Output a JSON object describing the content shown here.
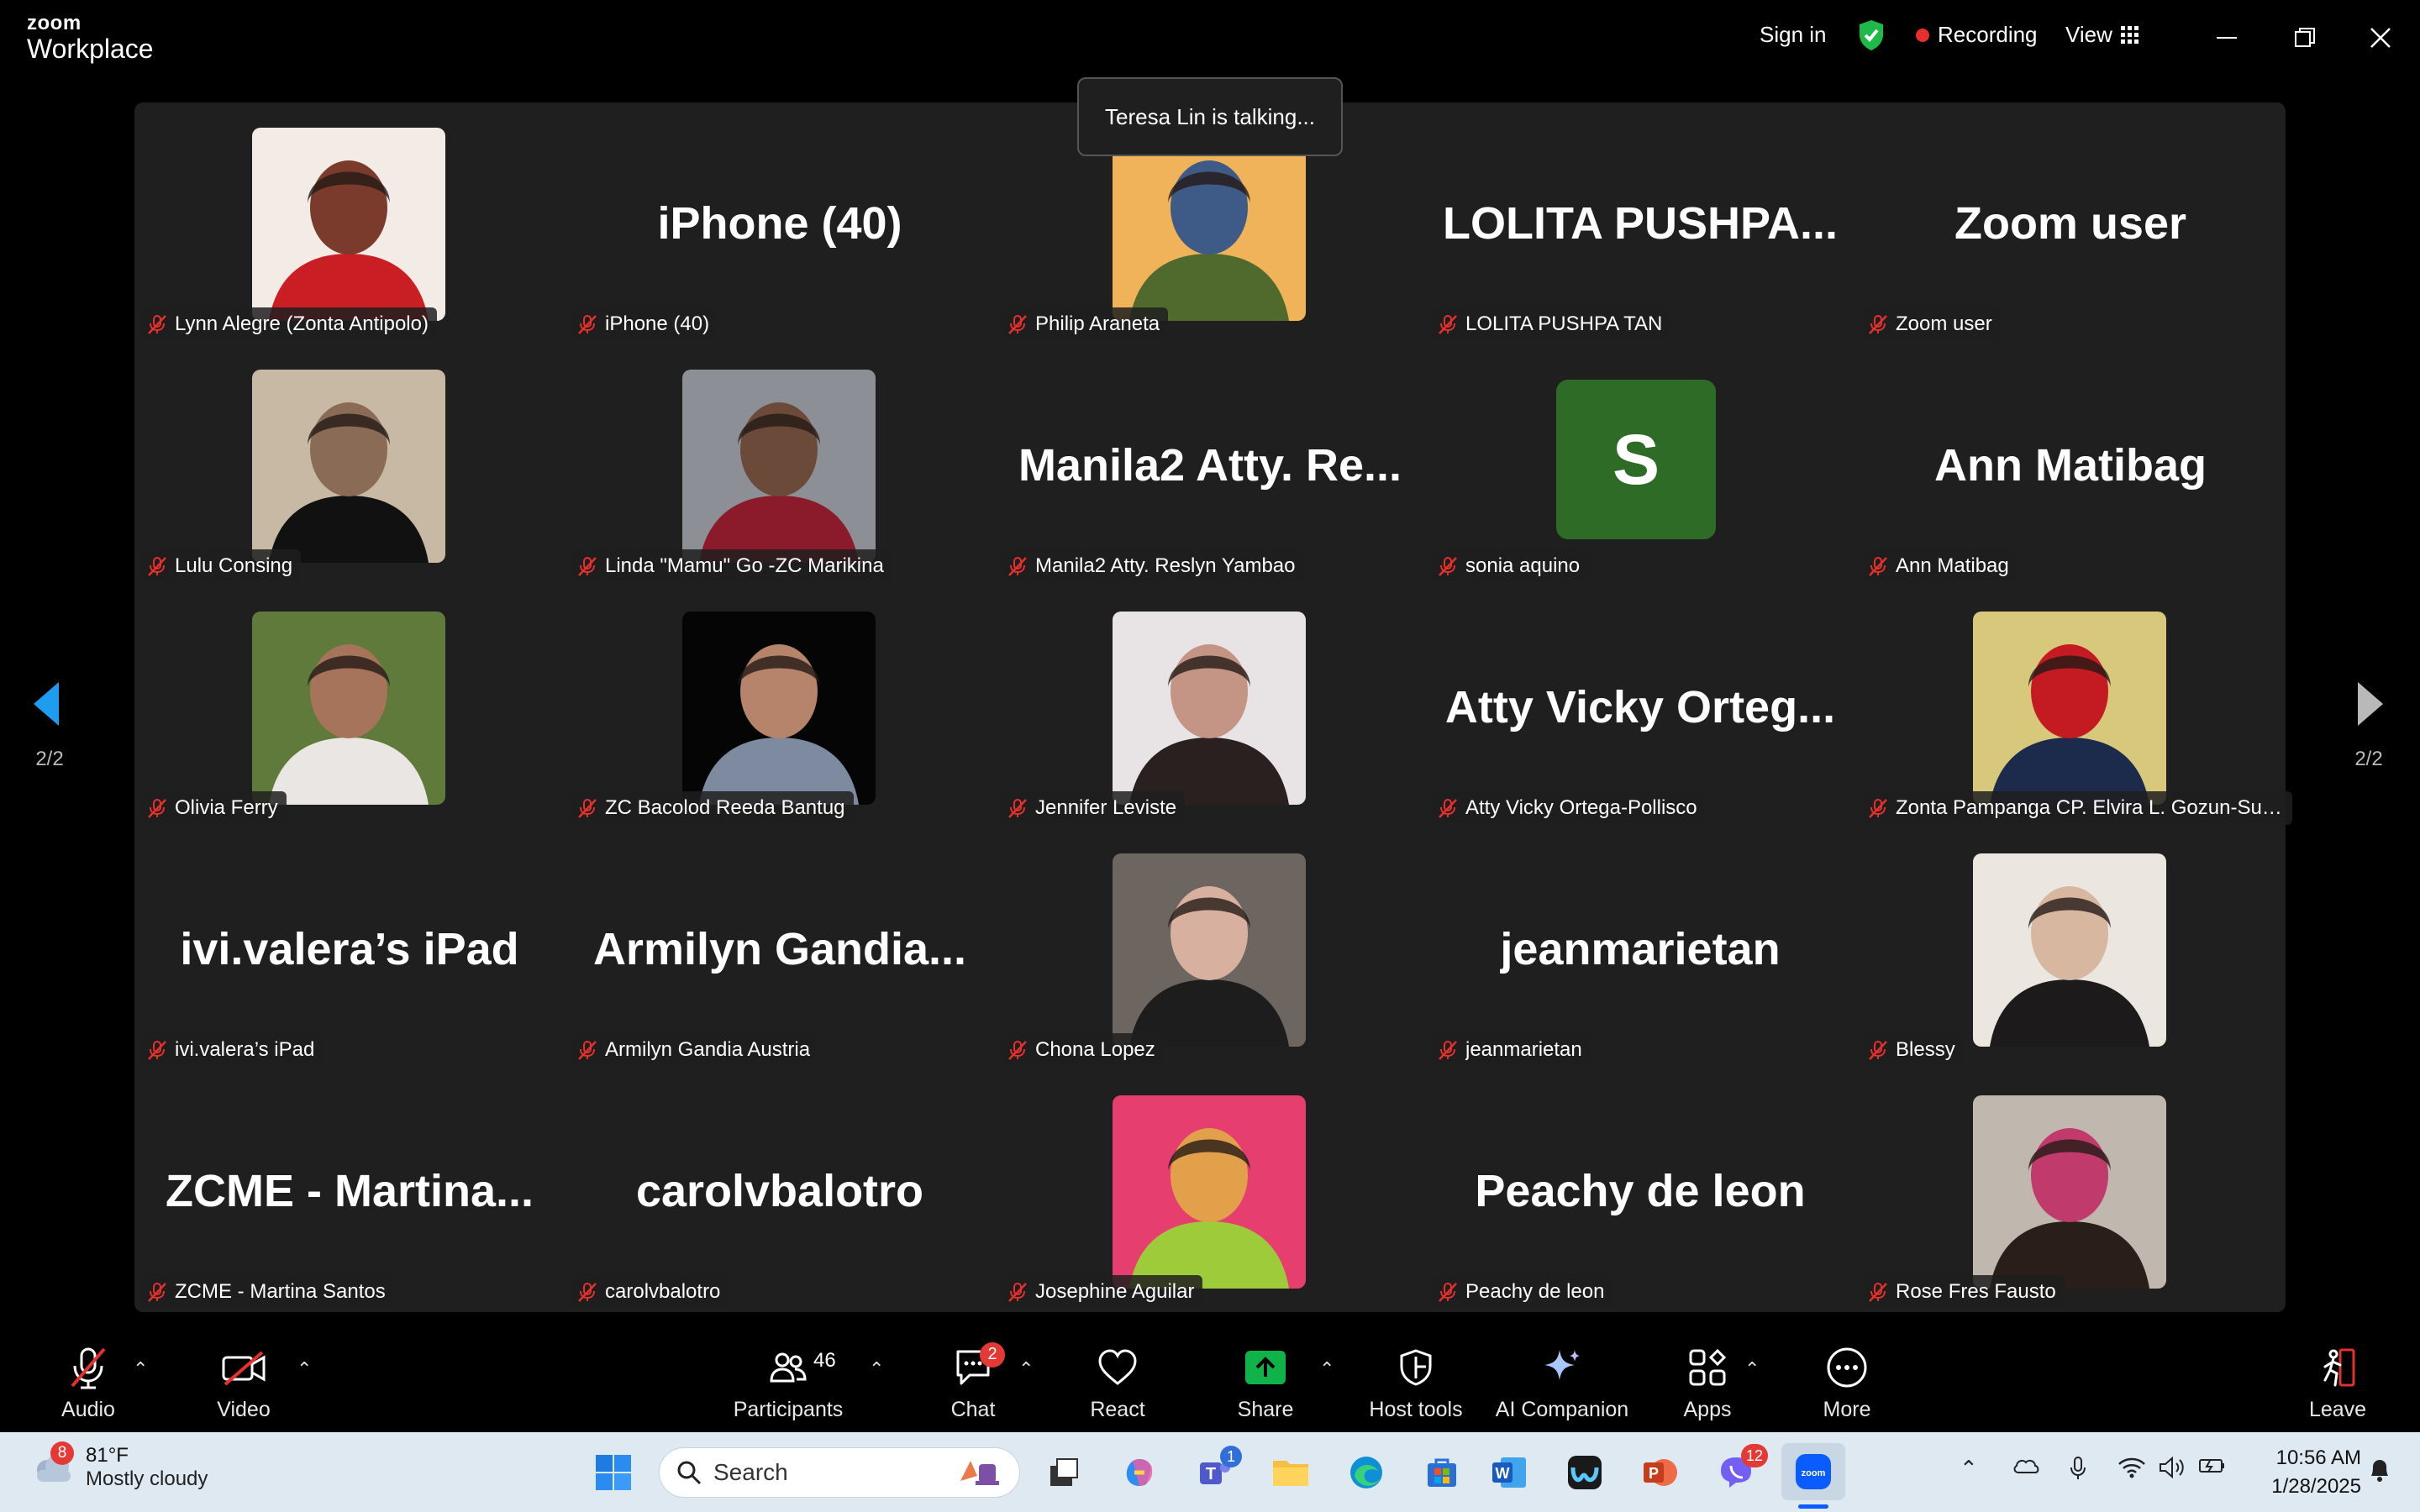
{
  "window": {
    "logo_small": "zoom",
    "logo_large": "Workplace",
    "sign_in": "Sign in",
    "recording": "Recording",
    "view": "View"
  },
  "talking_toast": "Teresa Lin is talking...",
  "pager": {
    "left": "2/2",
    "right": "2/2"
  },
  "tiles": [
    {
      "kind": "photo",
      "label": "Lynn Alegre (Zonta Antipolo)",
      "palette": [
        "#f3ece6",
        "#c91f24",
        "#7a3b2c"
      ]
    },
    {
      "kind": "text",
      "big": "iPhone (40)",
      "label": "iPhone (40)"
    },
    {
      "kind": "photo",
      "label": "Philip Araneta",
      "palette": [
        "#f0b35a",
        "#4f6a2c",
        "#3e5a86"
      ]
    },
    {
      "kind": "text",
      "big": "LOLITA  PUSHPA...",
      "label": "LOLITA PUSHPA TAN"
    },
    {
      "kind": "text",
      "big": "Zoom user",
      "label": "Zoom user"
    },
    {
      "kind": "photo",
      "label": "Lulu Consing",
      "palette": [
        "#c8b9a4",
        "#111111",
        "#8a6b55"
      ]
    },
    {
      "kind": "photo",
      "label": "Linda \"Mamu\" Go -ZC Marikina",
      "palette": [
        "#8d8f96",
        "#8b1a2b",
        "#6b4a3a"
      ]
    },
    {
      "kind": "text",
      "big": "Manila2  Atty.  Re...",
      "label": "Manila2 Atty. Reslyn Yambao"
    },
    {
      "kind": "initial",
      "big": "S",
      "label": "sonia aquino"
    },
    {
      "kind": "text",
      "big": "Ann Matibag",
      "label": "Ann Matibag"
    },
    {
      "kind": "photo",
      "label": "Olivia Ferry",
      "palette": [
        "#5f7a3a",
        "#e9e6e3",
        "#a5745a"
      ]
    },
    {
      "kind": "photo",
      "label": "ZC Bacolod Reeda Bantug",
      "palette": [
        "#050505",
        "#7e8aa0",
        "#b5846a"
      ]
    },
    {
      "kind": "photo",
      "label": "Jennifer Leviste",
      "palette": [
        "#e8e4e6",
        "#2a2020",
        "#c49484"
      ]
    },
    {
      "kind": "text",
      "big": "Atty  Vicky  Orteg...",
      "label": "Atty Vicky Ortega-Pollisco"
    },
    {
      "kind": "photo",
      "label": "Zonta Pampanga CP. Elvira L. Gozun-Sum...",
      "palette": [
        "#d8c87c",
        "#1c2a4c",
        "#c41b22"
      ]
    },
    {
      "kind": "text",
      "big": "ivi.valera’s iPad",
      "label": "ivi.valera’s iPad"
    },
    {
      "kind": "text",
      "big": "Armilyn  Gandia...",
      "label": "Armilyn Gandia Austria"
    },
    {
      "kind": "photo",
      "label": "Chona Lopez",
      "palette": [
        "#6d6560",
        "#1d1d1d",
        "#d8b0a0"
      ]
    },
    {
      "kind": "text",
      "big": "jeanmarietan",
      "label": "jeanmarietan"
    },
    {
      "kind": "photo",
      "label": "Blessy",
      "palette": [
        "#ece6e0",
        "#1c1a1a",
        "#d7b7a0"
      ]
    },
    {
      "kind": "text",
      "big": "ZCME  -  Martina...",
      "label": "ZCME - Martina Santos"
    },
    {
      "kind": "text",
      "big": "carolvbalotro",
      "label": "carolvbalotro"
    },
    {
      "kind": "photo",
      "label": "Josephine Aguilar",
      "palette": [
        "#e63f6f",
        "#9ecb3a",
        "#e2a04a"
      ]
    },
    {
      "kind": "text",
      "big": "Peachy de leon",
      "label": "Peachy de leon"
    },
    {
      "kind": "photo",
      "label": "Rose Fres Fausto",
      "palette": [
        "#c0b7ae",
        "#2a1e1a",
        "#c03a6c"
      ]
    }
  ],
  "toolbar": {
    "audio": "Audio",
    "video": "Video",
    "participants": "Participants",
    "participants_count": "46",
    "chat": "Chat",
    "chat_badge": "2",
    "react": "React",
    "share": "Share",
    "host_tools": "Host tools",
    "ai_companion": "AI Companion",
    "apps": "Apps",
    "more": "More",
    "leave": "Leave"
  },
  "taskbar": {
    "weather_badge": "8",
    "temp": "81°F",
    "condition": "Mostly cloudy",
    "search_placeholder": "Search",
    "teams_badge": "1",
    "viber_badge": "12",
    "time": "10:56 AM",
    "date": "1/28/2025"
  },
  "colors": {
    "accent_share": "#0fb34a",
    "muted_red": "#e5302e",
    "shield_green": "#1fb94a",
    "gallery_bg": "#1f1f1f"
  }
}
